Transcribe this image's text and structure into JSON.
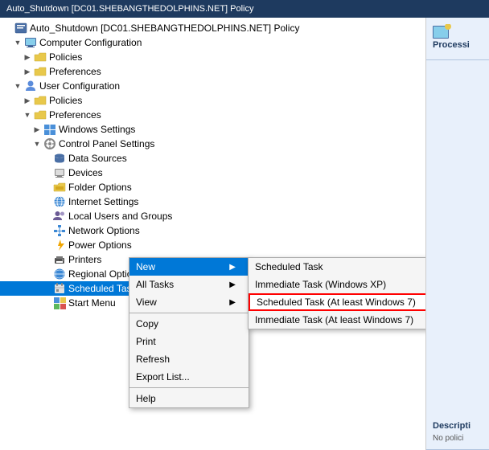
{
  "titleBar": {
    "text": "Auto_Shutdown [DC01.SHEBANGTHEDOLPHINS.NET] Policy"
  },
  "rightPanel": {
    "processingTitle": "Processi",
    "descriptionTitle": "Descripti",
    "descriptionText": "No polici"
  },
  "treeItems": [
    {
      "id": "root",
      "indent": 0,
      "expanded": true,
      "icon": "📋",
      "label": "Auto_Shutdown [DC01.SHEBANGTHEDOLPHINS.NET] Policy",
      "hasExpand": false
    },
    {
      "id": "computer-config",
      "indent": 1,
      "expanded": true,
      "icon": "🖥",
      "label": "Computer Configuration",
      "hasExpand": true
    },
    {
      "id": "cc-policies",
      "indent": 2,
      "expanded": false,
      "icon": "📁",
      "label": "Policies",
      "hasExpand": true
    },
    {
      "id": "cc-preferences",
      "indent": 2,
      "expanded": false,
      "icon": "📁",
      "label": "Preferences",
      "hasExpand": true
    },
    {
      "id": "user-config",
      "indent": 1,
      "expanded": true,
      "icon": "👤",
      "label": "User Configuration",
      "hasExpand": true
    },
    {
      "id": "uc-policies",
      "indent": 2,
      "expanded": false,
      "icon": "📁",
      "label": "Policies",
      "hasExpand": true
    },
    {
      "id": "uc-preferences",
      "indent": 2,
      "expanded": true,
      "icon": "📁",
      "label": "Preferences",
      "hasExpand": true
    },
    {
      "id": "windows-settings",
      "indent": 3,
      "expanded": false,
      "icon": "🪟",
      "label": "Windows Settings",
      "hasExpand": true
    },
    {
      "id": "control-panel",
      "indent": 3,
      "expanded": true,
      "icon": "⚙",
      "label": "Control Panel Settings",
      "hasExpand": true
    },
    {
      "id": "data-sources",
      "indent": 4,
      "expanded": false,
      "icon": "🗄",
      "label": "Data Sources",
      "hasExpand": false
    },
    {
      "id": "devices",
      "indent": 4,
      "expanded": false,
      "icon": "🖨",
      "label": "Devices",
      "hasExpand": false
    },
    {
      "id": "folder-options",
      "indent": 4,
      "expanded": false,
      "icon": "📂",
      "label": "Folder Options",
      "hasExpand": false
    },
    {
      "id": "internet-settings",
      "indent": 4,
      "expanded": false,
      "icon": "🌐",
      "label": "Internet Settings",
      "hasExpand": false
    },
    {
      "id": "local-users",
      "indent": 4,
      "expanded": false,
      "icon": "👥",
      "label": "Local Users and Groups",
      "hasExpand": false
    },
    {
      "id": "network-options",
      "indent": 4,
      "expanded": false,
      "icon": "🌐",
      "label": "Network Options",
      "hasExpand": false
    },
    {
      "id": "power-options",
      "indent": 4,
      "expanded": false,
      "icon": "⚡",
      "label": "Power Options",
      "hasExpand": false
    },
    {
      "id": "printers",
      "indent": 4,
      "expanded": false,
      "icon": "🖨",
      "label": "Printers",
      "hasExpand": false
    },
    {
      "id": "regional-options",
      "indent": 4,
      "expanded": false,
      "icon": "🌍",
      "label": "Regional Options",
      "hasExpand": false
    },
    {
      "id": "scheduled-tasks",
      "indent": 4,
      "expanded": false,
      "icon": "📅",
      "label": "Scheduled Tasks",
      "hasExpand": false,
      "selected": true
    },
    {
      "id": "start-menu",
      "indent": 4,
      "expanded": false,
      "icon": "🪟",
      "label": "Start Menu",
      "hasExpand": false
    }
  ],
  "contextMenu": {
    "items": [
      {
        "id": "new",
        "label": "New",
        "hasArrow": true,
        "highlighted": true
      },
      {
        "id": "all-tasks",
        "label": "All Tasks",
        "hasArrow": true
      },
      {
        "id": "view",
        "label": "View",
        "hasArrow": true
      },
      {
        "id": "sep1",
        "separator": true
      },
      {
        "id": "copy",
        "label": "Copy"
      },
      {
        "id": "print",
        "label": "Print"
      },
      {
        "id": "refresh",
        "label": "Refresh"
      },
      {
        "id": "export-list",
        "label": "Export List..."
      },
      {
        "id": "sep2",
        "separator": true
      },
      {
        "id": "help",
        "label": "Help"
      }
    ]
  },
  "submenu": {
    "items": [
      {
        "id": "scheduled-task",
        "label": "Scheduled Task"
      },
      {
        "id": "immediate-xp",
        "label": "Immediate Task (Windows XP)"
      },
      {
        "id": "scheduled-win7",
        "label": "Scheduled Task (At least Windows 7)",
        "highlightedRed": true
      },
      {
        "id": "immediate-win7",
        "label": "Immediate Task (At least Windows 7)"
      }
    ]
  }
}
